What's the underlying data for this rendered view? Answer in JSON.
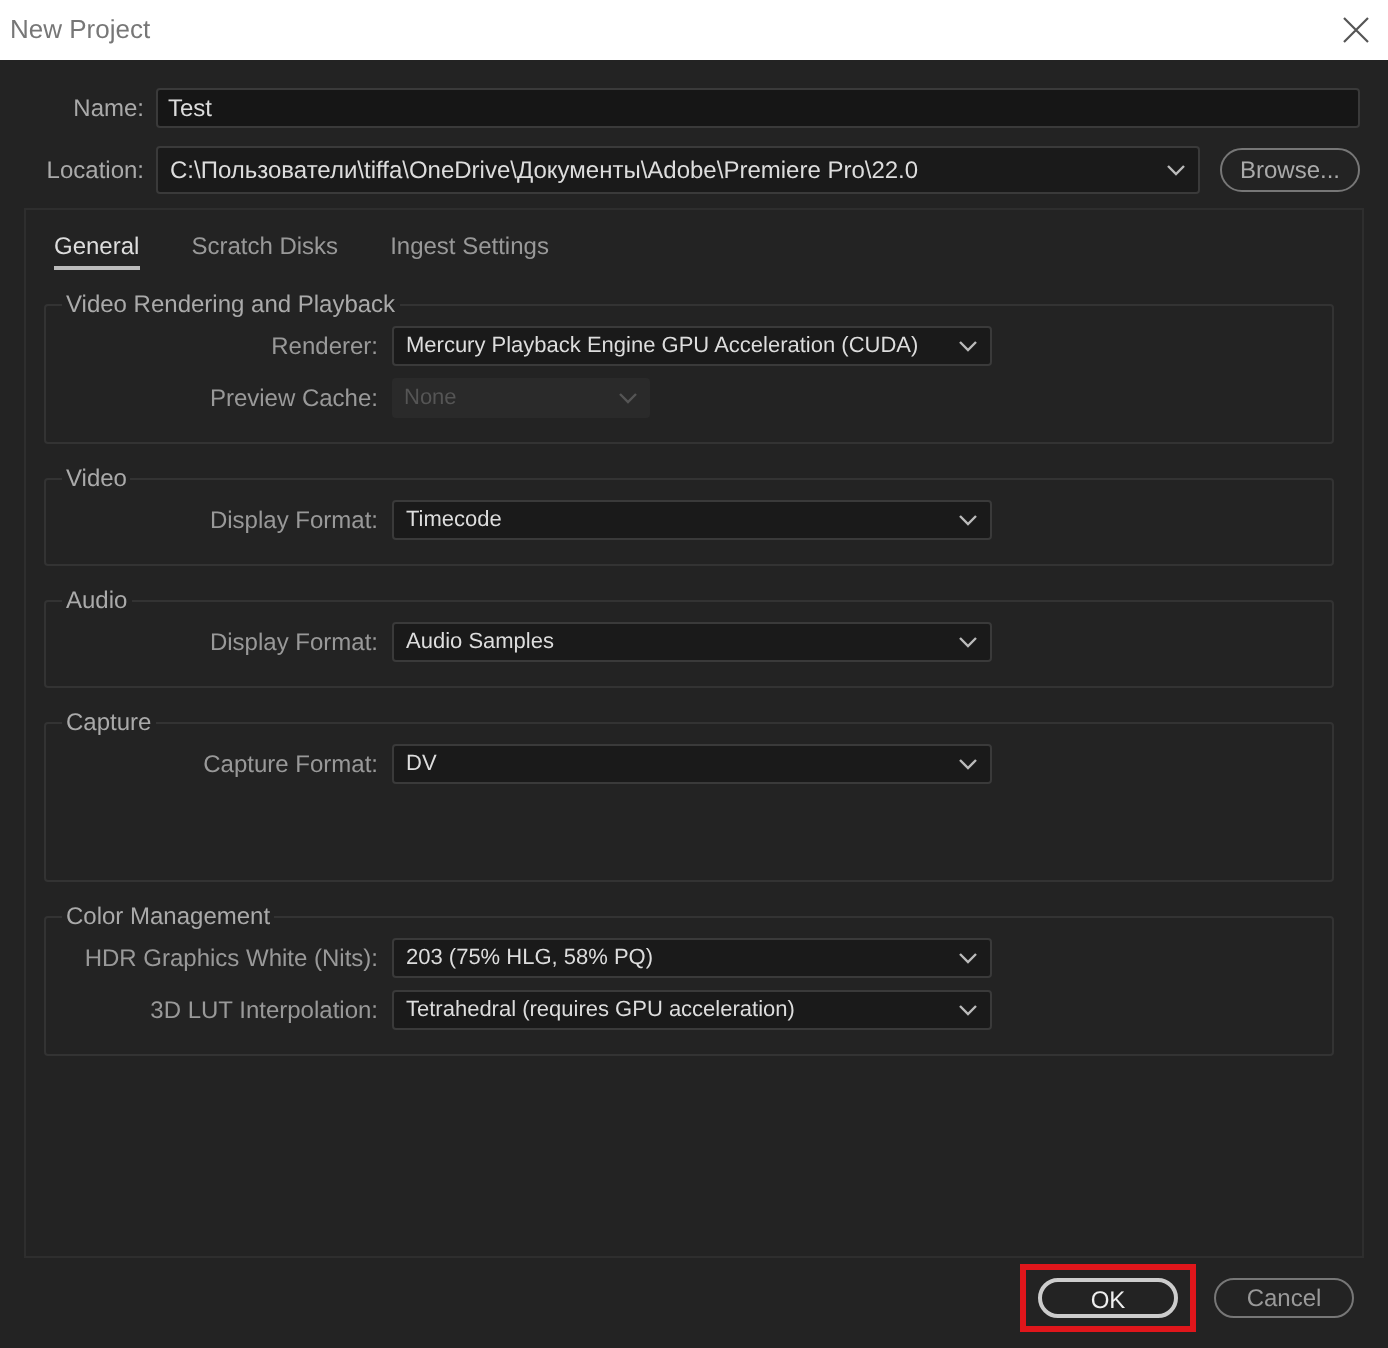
{
  "window": {
    "title": "New Project"
  },
  "name_field": {
    "label": "Name:",
    "value": "Test"
  },
  "location_field": {
    "label": "Location:",
    "value": "C:\\Пользователи\\tiffa\\OneDrive\\Документы\\Adobe\\Premiere Pro\\22.0"
  },
  "browse_button": "Browse...",
  "tabs": [
    {
      "label": "General",
      "selected": true
    },
    {
      "label": "Scratch Disks",
      "selected": false
    },
    {
      "label": "Ingest Settings",
      "selected": false
    }
  ],
  "groups": [
    {
      "title": "Video Rendering and Playback",
      "fields": [
        {
          "label": "Renderer:",
          "value": "Mercury Playback Engine GPU Acceleration (CUDA)",
          "disabled": false
        },
        {
          "label": "Preview Cache:",
          "value": "None",
          "disabled": true
        }
      ]
    },
    {
      "title": "Video",
      "fields": [
        {
          "label": "Display Format:",
          "value": "Timecode",
          "disabled": false
        }
      ]
    },
    {
      "title": "Audio",
      "fields": [
        {
          "label": "Display Format:",
          "value": "Audio Samples",
          "disabled": false
        }
      ]
    },
    {
      "title": "Capture",
      "fields": [
        {
          "label": "Capture Format:",
          "value": "DV",
          "disabled": false
        }
      ]
    },
    {
      "title": "Color Management",
      "fields": [
        {
          "label": "HDR Graphics White (Nits):",
          "value": "203 (75% HLG, 58% PQ)",
          "disabled": false
        },
        {
          "label": "3D LUT Interpolation:",
          "value": "Tetrahedral (requires GPU acceleration)",
          "disabled": false
        }
      ]
    }
  ],
  "buttons": [
    {
      "label": "OK",
      "highlighted": true
    },
    {
      "label": "Cancel",
      "highlighted": false
    }
  ]
}
